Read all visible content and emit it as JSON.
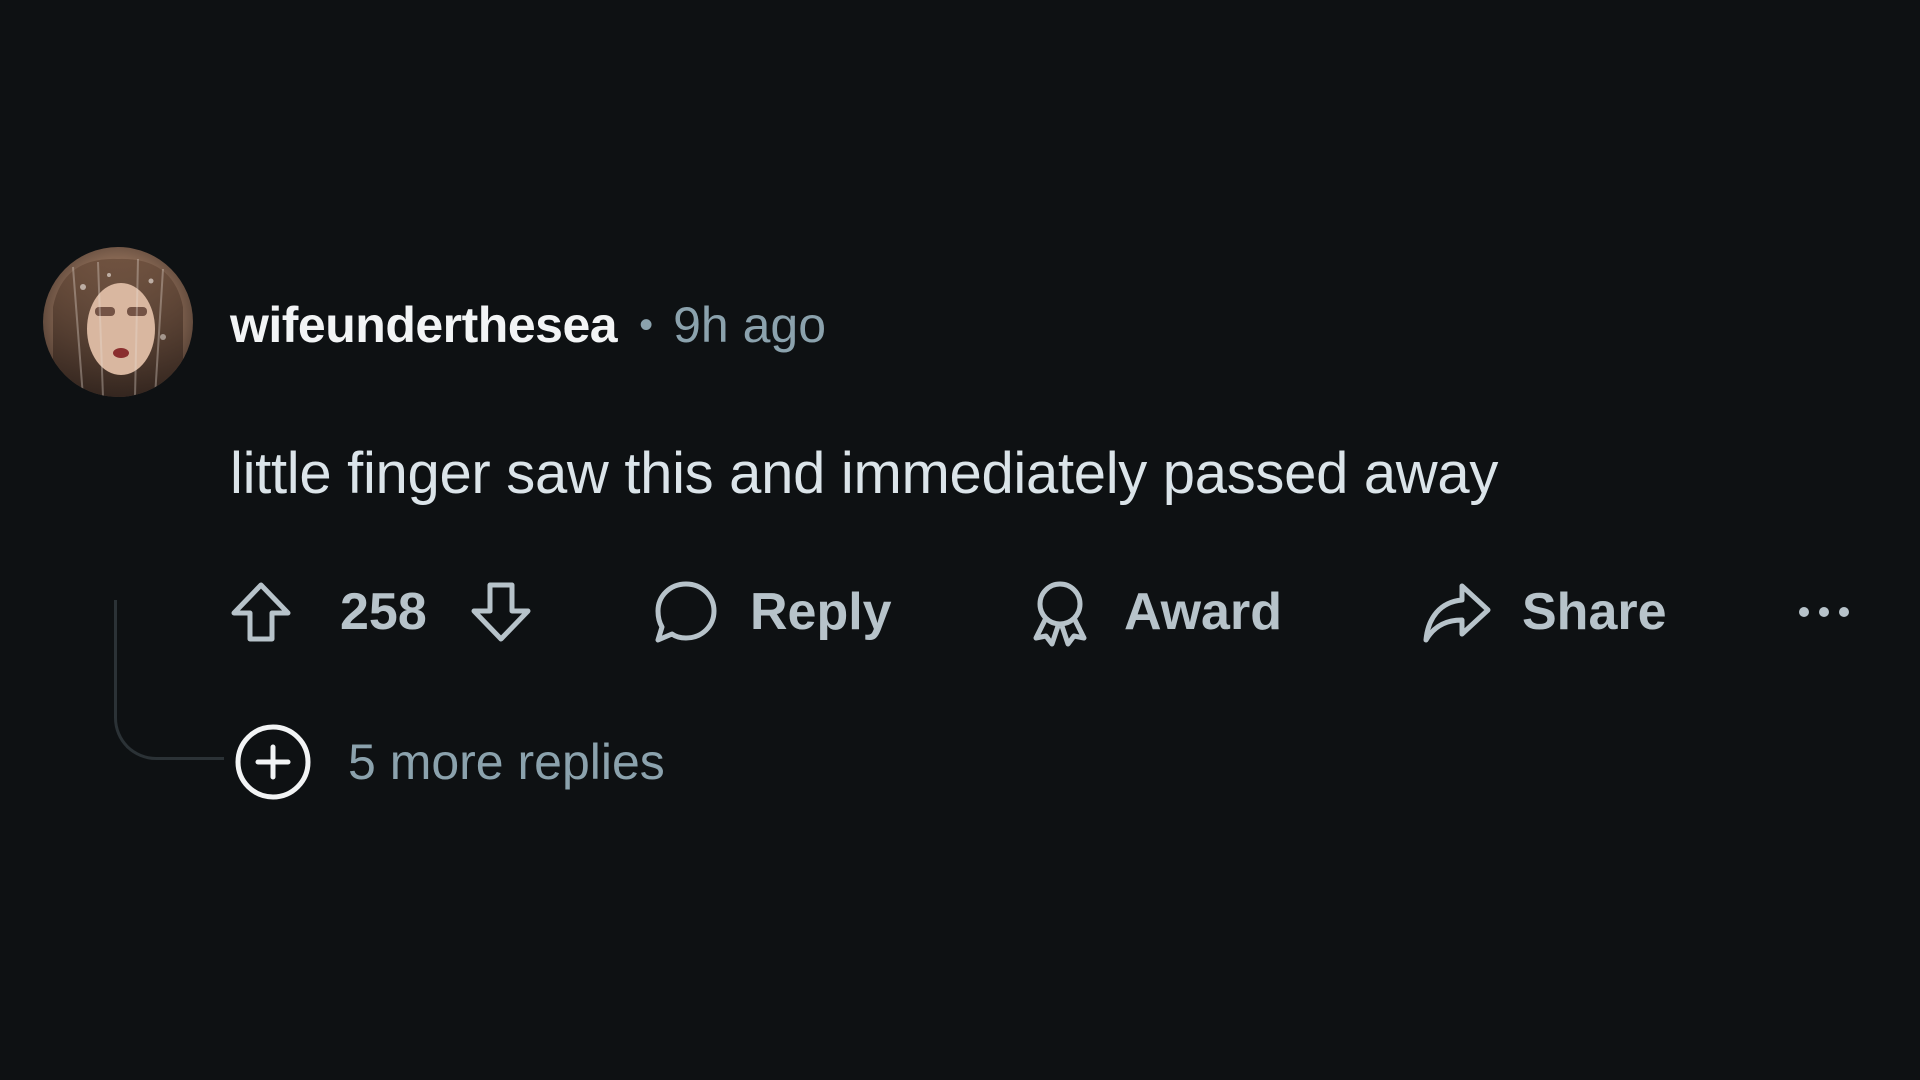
{
  "comment": {
    "author": "wifeunderthesea",
    "separator": "•",
    "timestamp": "9h ago",
    "body": "little finger saw this and immediately passed away",
    "avatar_icon": "user-avatar-photo"
  },
  "actions": {
    "upvote_icon": "arrow-up-icon",
    "score": "258",
    "downvote_icon": "arrow-down-icon",
    "reply_label": "Reply",
    "award_label": "Award",
    "share_label": "Share",
    "overflow_icon": "ellipsis-icon"
  },
  "replies": {
    "expand_icon": "plus-circle-icon",
    "label": "5 more replies"
  },
  "colors": {
    "background": "#0e1113",
    "username": "#f2f4f5",
    "body_text": "#dbe4e9",
    "action_text": "#b7c3ca",
    "muted_text": "#8ba2ad",
    "thread_line": "#2b3236"
  }
}
